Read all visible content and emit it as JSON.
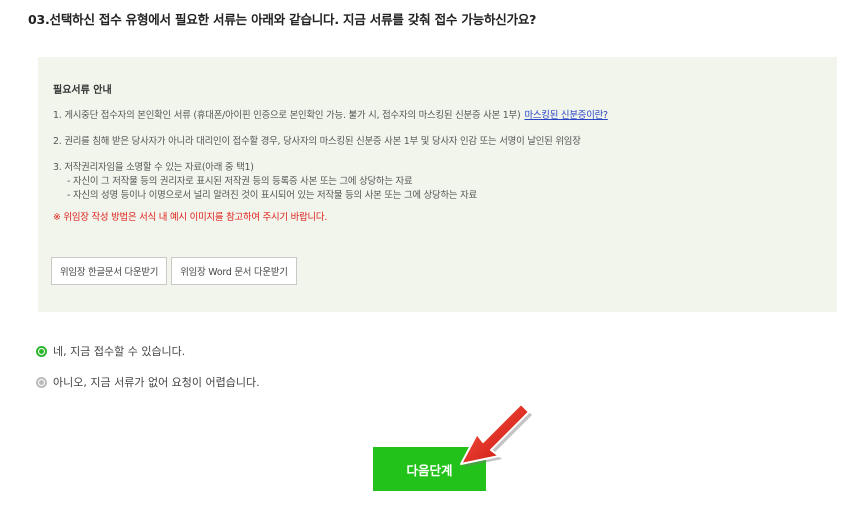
{
  "question": {
    "title": "03.선택하신 접수 유형에서 필요한 서류는 아래와 같습니다. 지금 서류를 갖춰 접수 가능하신가요?"
  },
  "notice": {
    "title": "필요서류 안내",
    "item1": "1. 게시중단 접수자의 본인확인 서류 (휴대폰/아이핀 인증으로 본인확인 가능. 불가 시, 접수자의 마스킹된 신분증 사본 1부)",
    "item1_link": "마스킹된 신분증이란?",
    "item2": "2. 권리를 침해 받은 당사자가 아니라 대리인이 접수할 경우, 당사자의 마스킹된 신분증 사본 1부 및 당사자 인감 또는 서명이 날인된 위임장",
    "item3": "3. 저작권리자임을 소명할 수 있는 자료(아래 중 택1)",
    "item3_sub1": "- 자신이 그 저작물 등의 권리자로 표시된 저작권 등의 등록증 사본 또는 그에 상당하는 자료",
    "item3_sub2": "- 자신의 성명 등이나 이명으로서 널리 알려진 것이 표시되어 있는 저작물 등의 사본 또는 그에 상당하는 자료",
    "warning": "※ 위임장 작성 방법은 서식 내 예시 이미지를 참고하여 주시기 바랍니다."
  },
  "downloads": {
    "hwp_label": "위임장 한글문서 다운받기",
    "word_label": "위임장 Word 문서 다운받기"
  },
  "options": {
    "yes_label": "네, 지금 접수할 수 있습니다.",
    "yes_selected": true,
    "no_label": "아니오, 지금 서류가 없어 요청이 어렵습니다.",
    "no_selected": false
  },
  "next_button": {
    "label": "다음단계"
  },
  "colors": {
    "accent_green": "#23c21a",
    "radio_green": "#2fb62f",
    "warning_red": "#e0201c",
    "link_blue": "#2b46c4",
    "notice_bg": "#f1f5ec",
    "arrow_red": "#e11d12"
  },
  "icons": {
    "radio_checked": "radio-checked-icon",
    "radio_unchecked": "radio-unchecked-icon",
    "arrow": "red-arrow-pointer-icon"
  }
}
